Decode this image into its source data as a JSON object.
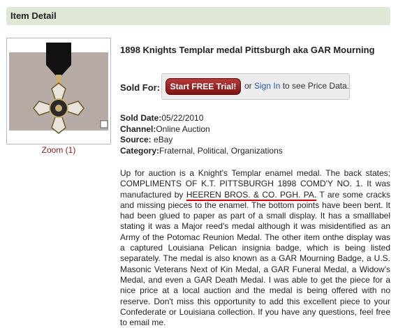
{
  "header": {
    "title": "Item Detail"
  },
  "image": {
    "zoom_label": "Zoom (1)"
  },
  "item": {
    "title": "1898 Knights Templar medal Pittsburgh aka GAR Mourning"
  },
  "sold_for": {
    "label": "Sold For:",
    "trial_button": "Start FREE Trial!",
    "or_text": "or",
    "signin_link": "Sign In",
    "suffix_text": "to see Price Data."
  },
  "details": {
    "sold_date_label": "Sold Date:",
    "sold_date_value": "05/22/2010",
    "channel_label": "Channel:",
    "channel_value": "Online Auction",
    "source_label": "Source:",
    "source_value": "eBay",
    "category_label": "Category:",
    "category_value": "Fraternal, Political, Organizations"
  },
  "description": {
    "part1": "Up for auction is a Knight's Templar enamel medal. The back states; COMPLIMENTS OF K.T. PITTSBURGH 1898 COMD'Y NO. 1. It was manufactured by ",
    "highlight": "HEEREN BROS. & CO. PGH. PA.",
    "part2": " T are some cracks and missing pieces to the enamel. The bottom points have been bent. It had been glued to paper as part of a small display. It has a smalllabel stating it was a Major reed's medal although it was misidentified as an Army of the Potomac Reunion Medal. The other item onthe display was a captured Louisiana Pelican insignia badge, which is being listed separately. The medal is also known as a GAR Mourning Badge, a U.S. Masonic Veterans Next of Kin Medal, a GAR Funeral Medal, a Widow's Medal, and even a GAR Death Medal. I was able to get the piece for a nice price at a local auction and the medal is being offered with no reserve. Don't miss this opportunity to add this excellent piece to your Confederate or Louisiana collection. If you have any questions, feel free to email me."
  },
  "colors": {
    "header_bg": "#dfe8d5",
    "trial_button": "#9b2323",
    "link_blue": "#2a5db0",
    "zoom_red": "#8b1a1a",
    "underline_red": "#d40000"
  }
}
